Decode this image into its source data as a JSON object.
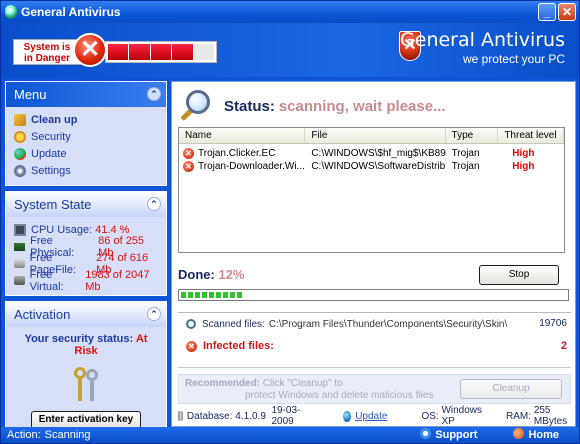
{
  "window": {
    "title": "General Antivirus"
  },
  "header": {
    "danger_line1": "System is",
    "danger_line2": "in Danger",
    "danger_x": "✕",
    "brand_name": "General Antivirus",
    "brand_tagline": "we protect your PC",
    "danger_level_filled_segments": 4,
    "danger_level_total_segments": 5
  },
  "menu": {
    "title": "Menu",
    "items": [
      {
        "label": "Clean up",
        "icon": "broom-icon",
        "bold": true
      },
      {
        "label": "Security",
        "icon": "security-icon"
      },
      {
        "label": "Update",
        "icon": "update-icon"
      },
      {
        "label": "Settings",
        "icon": "settings-icon"
      }
    ]
  },
  "system_state": {
    "title": "System State",
    "cpu_label": "CPU Usage:",
    "cpu_value": "41.4 %",
    "phys_label": "Free Physical:",
    "phys_value": "86 of 255 Mb",
    "page_label": "Free PageFile:",
    "page_value": "274 of 616 Mb",
    "virt_label": "Free Virtual:",
    "virt_value": "1983 of 2047 Mb"
  },
  "activation": {
    "title": "Activation",
    "status_label": "Your security status:",
    "status_value": "At Risk",
    "button_label": "Enter activation key"
  },
  "scan": {
    "status_label": "Status:",
    "status_value": "scanning, wait please...",
    "columns": [
      "Name",
      "File",
      "Type",
      "Threat level"
    ],
    "rows": [
      {
        "name": "Trojan.Clicker.EC",
        "file": "C:\\WINDOWS\\$hf_mig$\\KB89...",
        "type": "Trojan",
        "threat": "High"
      },
      {
        "name": "Trojan-Downloader.Wi...",
        "file": "C:\\WINDOWS\\SoftwareDistrib...",
        "type": "Trojan",
        "threat": "High"
      }
    ],
    "done_label": "Done:",
    "done_value": "12%",
    "progress_percent": 12,
    "stop_label": "Stop",
    "scanned_label": "Scanned files:",
    "scanned_path": "C:\\Program Files\\Thunder\\Components\\Security\\Skin\\",
    "scanned_count": "19706",
    "infected_label": "Infected files:",
    "infected_count": "2"
  },
  "recommendation": {
    "label": "Recommended:",
    "line1": "Click \"Cleanup\" to",
    "line2": "protect Windows and delete malicious files",
    "button_label": "Cleanup"
  },
  "info": {
    "database_label": "Database:",
    "database_value": "4.1.0.9",
    "database_date": "19-03-2009",
    "update_label": "Update",
    "os_label": "OS:",
    "os_value": "Windows XP",
    "ram_label": "RAM:",
    "ram_value": "255 MBytes"
  },
  "statusbar": {
    "action_label": "Action:",
    "action_value": "Scanning",
    "support_label": "Support",
    "home_label": "Home"
  }
}
